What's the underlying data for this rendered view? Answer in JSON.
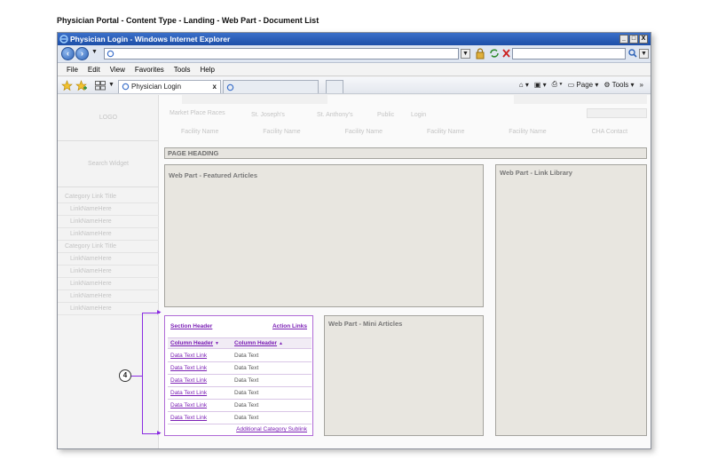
{
  "document_title": "Physician Portal - Content Type - Landing - Web Part - Document List",
  "window": {
    "title": "Physician Login - Windows Internet Explorer",
    "buttons": [
      "_",
      "□",
      "X"
    ]
  },
  "menu": [
    "File",
    "Edit",
    "View",
    "Favorites",
    "Tools",
    "Help"
  ],
  "tab": {
    "label": "Physician Login",
    "close": "x"
  },
  "command_bar": {
    "page_label": "Page",
    "tools_label": "Tools",
    "more": "»"
  },
  "ghost": {
    "logo": "LOGO",
    "search_widget": "Search Widget",
    "nav_tabs": [
      "Market Place Races",
      "St. Joseph's",
      "St. Anthony's",
      "Public",
      "Login"
    ],
    "facilities": [
      "Facility Name",
      "Facility Name",
      "Facility Name",
      "Facility Name",
      "Facility Name",
      "CHA Contact"
    ],
    "categories": [
      {
        "title": "Category Link Title",
        "links": [
          "LinkNameHere",
          "LinkNameHere",
          "LinkNameHere"
        ]
      },
      {
        "title": "Category Link Title",
        "links": [
          "LinkNameHere",
          "LinkNameHere",
          "LinkNameHere",
          "LinkNameHere",
          "LinkNameHere"
        ]
      }
    ]
  },
  "page_heading": "PAGE HEADING",
  "web_parts": {
    "featured": "Web Part - Featured Articles",
    "link_library": "Web Part - Link Library",
    "mini": "Web Part - Mini Articles"
  },
  "document_list": {
    "section_header": "Section Header",
    "action_links": "Action Links",
    "column_headers": [
      "Column Header",
      "Column Header"
    ],
    "rows": [
      {
        "link": "Data Text Link",
        "text": "Data Text"
      },
      {
        "link": "Data Text Link",
        "text": "Data Text"
      },
      {
        "link": "Data Text Link",
        "text": "Data Text"
      },
      {
        "link": "Data Text Link",
        "text": "Data Text"
      },
      {
        "link": "Data Text Link",
        "text": "Data Text"
      },
      {
        "link": "Data Text Link",
        "text": "Data Text"
      }
    ],
    "footer_link": "Additional Category Sublink"
  },
  "callout_number": "4",
  "colors": {
    "accent": "#8a2be2",
    "link": "#7b1fb5",
    "panel": "#e8e6e0"
  }
}
